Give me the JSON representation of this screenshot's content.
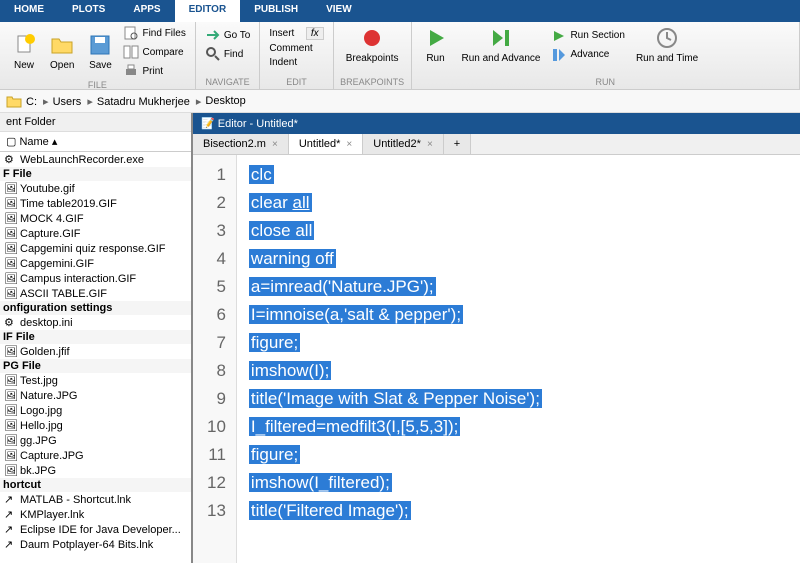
{
  "tabs": [
    "HOME",
    "PLOTS",
    "APPS",
    "EDITOR",
    "PUBLISH",
    "VIEW"
  ],
  "activeTab": "EDITOR",
  "ribbon": {
    "file": {
      "title": "FILE",
      "new": "New",
      "open": "Open",
      "save": "Save",
      "findFiles": "Find Files",
      "compare": "Compare",
      "print": "Print"
    },
    "navigate": {
      "title": "NAVIGATE",
      "goto": "Go To",
      "find": "Find"
    },
    "edit": {
      "title": "EDIT",
      "insert": "Insert",
      "comment": "Comment",
      "indent": "Indent",
      "fx": "fx"
    },
    "breakpoints": {
      "title": "BREAKPOINTS",
      "label": "Breakpoints"
    },
    "run": {
      "title": "RUN",
      "run": "Run",
      "runAdvance": "Run and Advance",
      "runSection": "Run Section",
      "advance": "Advance",
      "runTime": "Run and Time"
    }
  },
  "breadcrumb": [
    "C:",
    "Users",
    "Satadru Mukherjee",
    "Desktop"
  ],
  "folderPanelTitle": "ent Folder",
  "folderHeader": "Name",
  "folderItems": [
    {
      "type": "exe",
      "name": "WebLaunchRecorder.exe"
    },
    {
      "type": "section",
      "name": "F File"
    },
    {
      "type": "gif",
      "name": "Youtube.gif"
    },
    {
      "type": "gif",
      "name": "Time table2019.GIF"
    },
    {
      "type": "gif",
      "name": "MOCK 4.GIF"
    },
    {
      "type": "gif",
      "name": "Capture.GIF"
    },
    {
      "type": "gif",
      "name": "Capgemini quiz response.GIF"
    },
    {
      "type": "gif",
      "name": "Capgemini.GIF"
    },
    {
      "type": "gif",
      "name": "Campus interaction.GIF"
    },
    {
      "type": "gif",
      "name": "ASCII TABLE.GIF"
    },
    {
      "type": "section",
      "name": "onfiguration settings"
    },
    {
      "type": "ini",
      "name": "desktop.ini"
    },
    {
      "type": "section",
      "name": "IF File"
    },
    {
      "type": "jfif",
      "name": "Golden.jfif"
    },
    {
      "type": "section",
      "name": "PG File"
    },
    {
      "type": "jpg",
      "name": "Test.jpg"
    },
    {
      "type": "jpg",
      "name": "Nature.JPG"
    },
    {
      "type": "jpg",
      "name": "Logo.jpg"
    },
    {
      "type": "jpg",
      "name": "Hello.jpg"
    },
    {
      "type": "jpg",
      "name": "gg.JPG"
    },
    {
      "type": "jpg",
      "name": "Capture.JPG"
    },
    {
      "type": "jpg",
      "name": "bk.JPG"
    },
    {
      "type": "section",
      "name": "hortcut"
    },
    {
      "type": "lnk",
      "name": "MATLAB - Shortcut.lnk"
    },
    {
      "type": "lnk",
      "name": "KMPlayer.lnk"
    },
    {
      "type": "lnk",
      "name": "Eclipse IDE for Java Developer..."
    },
    {
      "type": "lnk",
      "name": "Daum Potplayer-64 Bits.lnk"
    }
  ],
  "editor": {
    "title": "Editor - Untitled*",
    "tabs": [
      {
        "name": "Bisection2.m",
        "active": false
      },
      {
        "name": "Untitled*",
        "active": true
      },
      {
        "name": "Untitled2*",
        "active": false
      }
    ],
    "lines": [
      {
        "num": 1,
        "text": "clc"
      },
      {
        "num": 2,
        "text": "clear all",
        "underline": "all"
      },
      {
        "num": 3,
        "text": "close all"
      },
      {
        "num": 4,
        "text": "warning off"
      },
      {
        "num": 5,
        "text": "a=imread('Nature.JPG');"
      },
      {
        "num": 6,
        "text": "I=imnoise(a,'salt & pepper');"
      },
      {
        "num": 7,
        "text": "figure;"
      },
      {
        "num": 8,
        "text": "imshow(I);"
      },
      {
        "num": 9,
        "text": "title('Image with Slat & Pepper Noise');"
      },
      {
        "num": 10,
        "text": "I_filtered=medfilt3(I,[5,5,3]);"
      },
      {
        "num": 11,
        "text": "figure;"
      },
      {
        "num": 12,
        "text": "imshow(I_filtered);"
      },
      {
        "num": 13,
        "text": "title('Filtered Image');"
      }
    ]
  }
}
